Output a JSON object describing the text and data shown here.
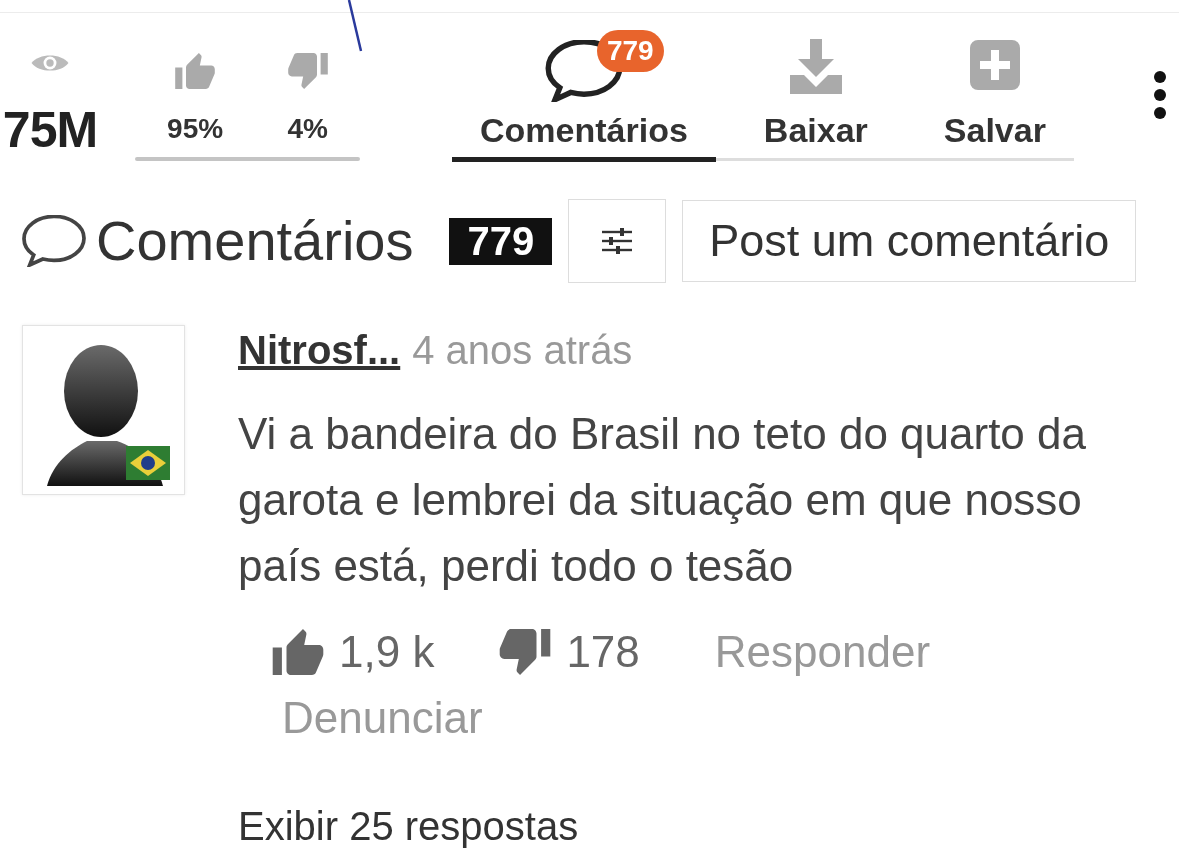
{
  "video_stats": {
    "views": "75M",
    "likes": "95%",
    "dislikes": "4%"
  },
  "tabs": [
    {
      "kind": "comments",
      "label": "Comentários",
      "badge": "779",
      "selected": true
    },
    {
      "kind": "download",
      "label": "Baixar",
      "selected": false
    },
    {
      "kind": "save",
      "label": "Salvar",
      "selected": false
    }
  ],
  "comments_header": {
    "title": "Comentários",
    "count": "779",
    "post_button": "Post um comentário"
  },
  "comments": [
    {
      "author": "Nitrosf...",
      "time": "4 anos atrás",
      "text": "Vi a bandeira do Brasil no teto do quarto da garota e lembrei da situação em que nosso país está, perdi todo o tesão",
      "likes": "1,9 k",
      "dislikes": "178",
      "actions": [
        "Responder",
        "Denunciar"
      ],
      "replies_link": "Exibir 25 respostas"
    }
  ]
}
